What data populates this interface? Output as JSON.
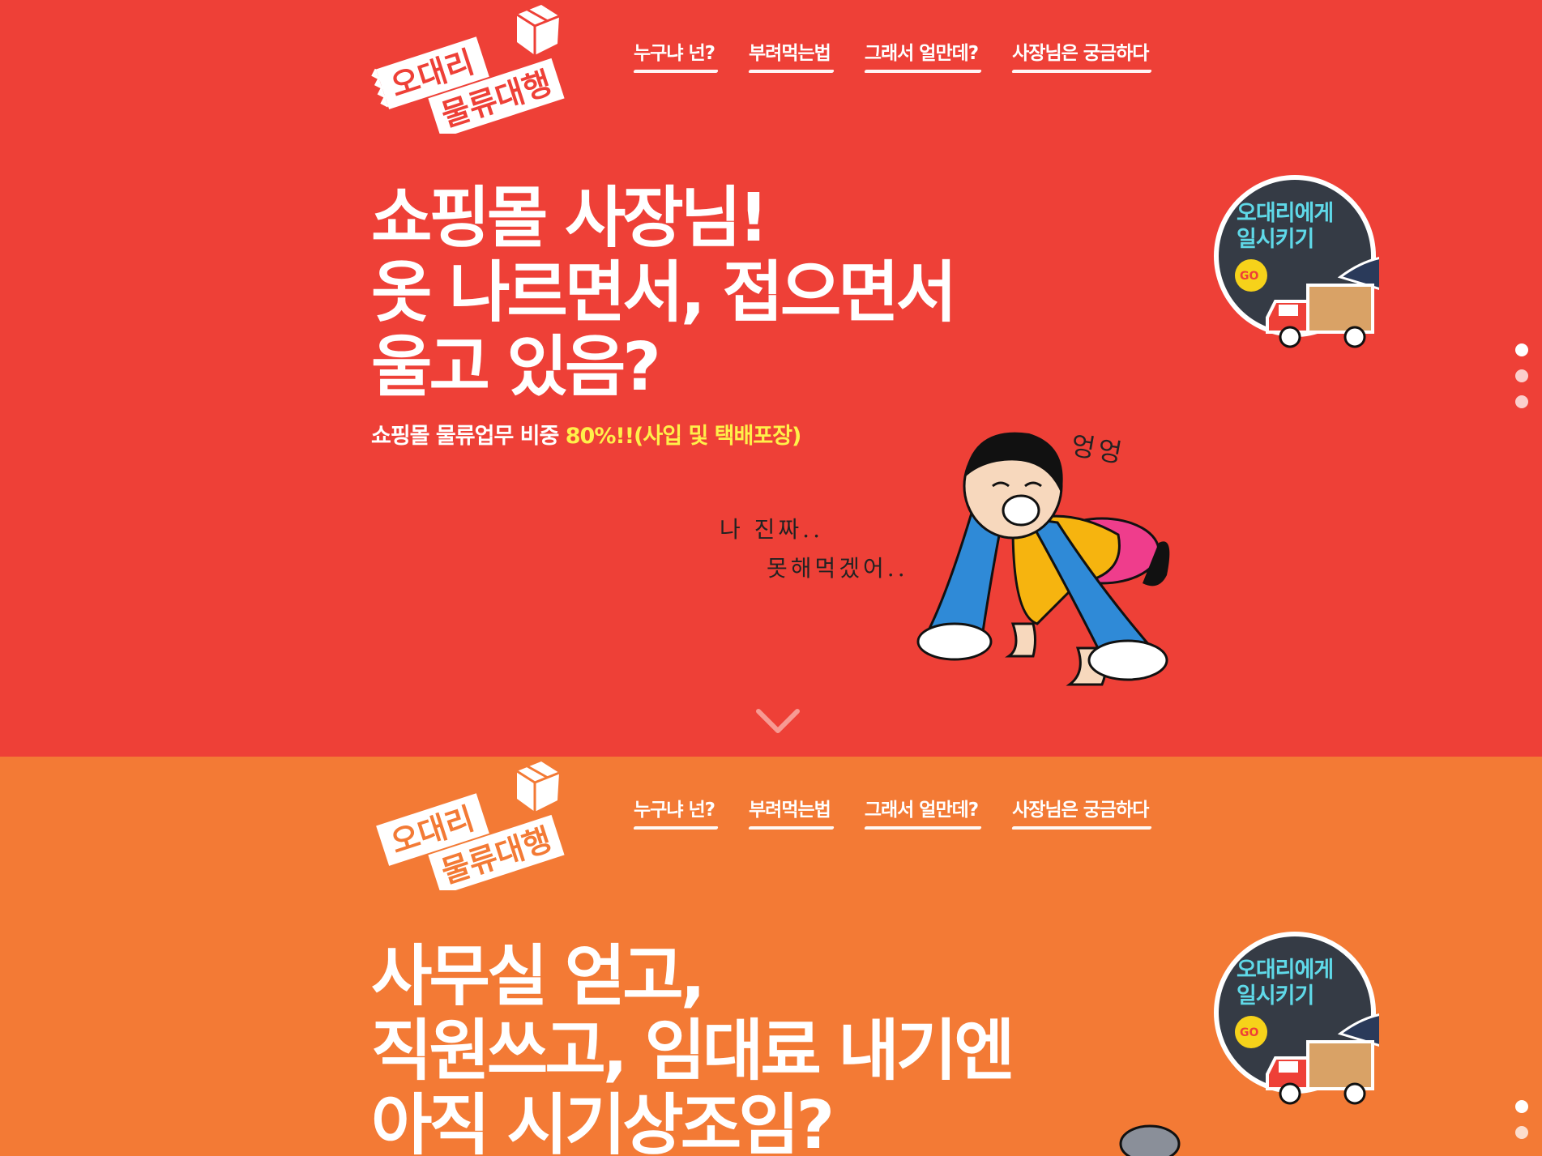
{
  "colors": {
    "section1_bg": "#ee4037",
    "section2_bg": "#f37a35",
    "highlight": "#fff04a",
    "badge_bg": "#353b45",
    "badge_text": "#5fd9e8"
  },
  "logo": {
    "line1": "오대리",
    "line2": "물류대행",
    "icon": "box-icon"
  },
  "nav": {
    "items": [
      {
        "label": "누구냐 넌?"
      },
      {
        "label": "부려먹는법"
      },
      {
        "label": "그래서 얼만데?"
      },
      {
        "label": "사장님은 궁금하다"
      }
    ]
  },
  "section1": {
    "headline": [
      "쇼핑몰 사장님!",
      "옷 나르면서, 접으면서",
      "울고 있음?"
    ],
    "sub_text": "쇼핑몰 물류업무 비중 ",
    "sub_highlight": "80%!!(사입 및 택배포장)",
    "speech_line1": "나 진짜..",
    "speech_line2": "못해먹겠어..",
    "crying_sound": "엉엉",
    "scroll_icon": "chevron-down-icon"
  },
  "section2": {
    "headline": [
      "사무실 얻고,",
      "직원쓰고, 임대료 내기엔",
      "아직 시기상조임?"
    ]
  },
  "badge": {
    "line1": "오대리에게",
    "line2": "일시키기",
    "go": "GO",
    "icon": "delivery-truck-icon"
  }
}
